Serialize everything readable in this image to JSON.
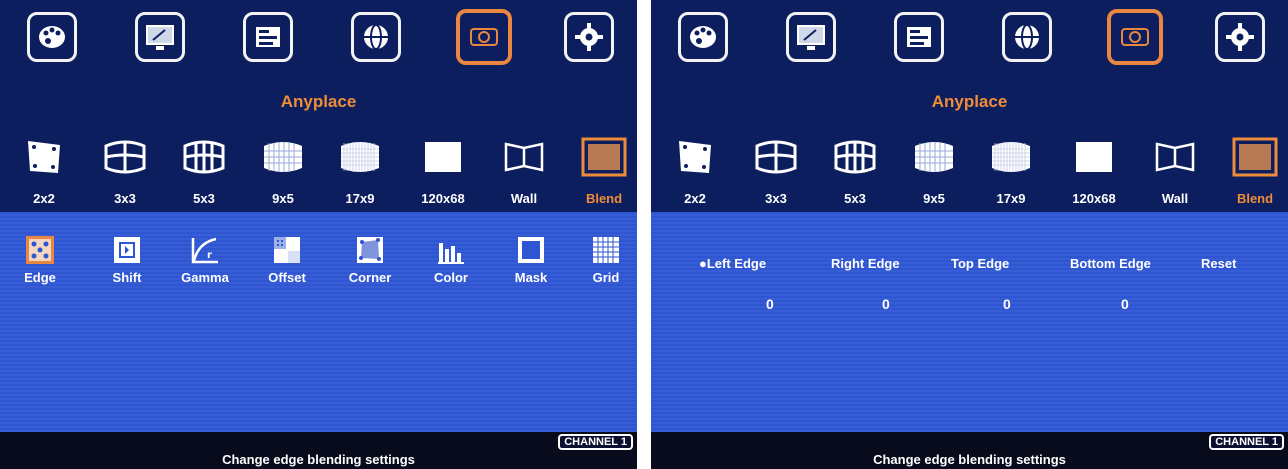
{
  "screens": [
    {
      "top_icons": [
        "palette-icon",
        "monitor-edit-icon",
        "layout-icon",
        "globe-icon",
        "projector-icon",
        "gear-icon"
      ],
      "active_top_icon": "projector-icon",
      "title": "Anyplace",
      "modes": [
        "2x2",
        "3x3",
        "5x3",
        "9x5",
        "17x9",
        "120x68",
        "Wall",
        "Blend"
      ],
      "active_mode": "Blend",
      "sub_items": [
        "Edge",
        "Shift",
        "Gamma",
        "Offset",
        "Corner",
        "Color",
        "Mask",
        "Grid"
      ],
      "status_message": "Change edge blending settings",
      "channel": "CHANNEL 1"
    },
    {
      "top_icons": [
        "palette-icon",
        "monitor-edit-icon",
        "layout-icon",
        "globe-icon",
        "projector-icon",
        "gear-icon"
      ],
      "active_top_icon": "projector-icon",
      "title": "Anyplace",
      "modes": [
        "2x2",
        "3x3",
        "5x3",
        "9x5",
        "17x9",
        "120x68",
        "Wall",
        "Blend"
      ],
      "active_mode": "Blend",
      "edge_headers": [
        "●Left Edge",
        "Right Edge",
        "Top Edge",
        "Bottom Edge",
        "Reset"
      ],
      "edge_values": [
        "0",
        "0",
        "0",
        "0"
      ],
      "status_message": "Change edge blending settings",
      "channel": "CHANNEL 1"
    }
  ],
  "colors": {
    "background": "#0c1e5e",
    "panel": "#2f56d2",
    "accent": "#ee8c3a",
    "status_bar": "#070b1c"
  }
}
